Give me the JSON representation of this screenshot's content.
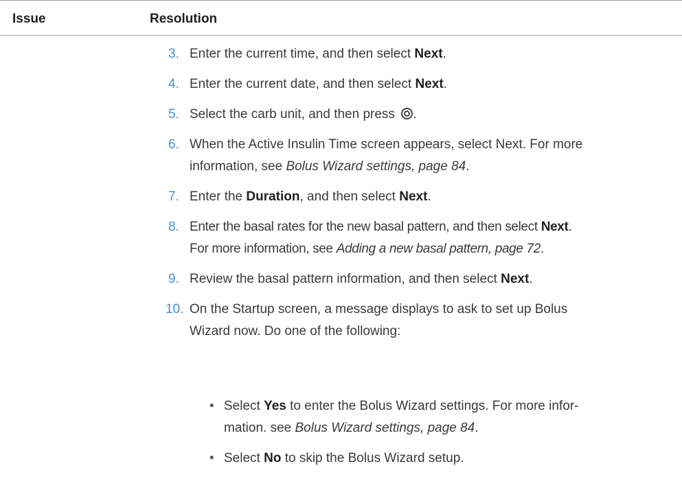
{
  "table": {
    "header_issue": "Issue",
    "header_resolution": "Resolution"
  },
  "steps": [
    {
      "num": "3.",
      "pre": "Enter the current time, and then select ",
      "bold": "Next",
      "post": "."
    },
    {
      "num": "4.",
      "pre": "Enter the current date, and then select ",
      "bold": "Next",
      "post": "."
    },
    {
      "num": "5.",
      "pre": "Select the carb unit, and then press ",
      "icon": "select-button-icon",
      "post": "."
    },
    {
      "num": "6.",
      "line1": "When the Active Insulin Time screen appears, select Next. For more",
      "line2_pre": "information, see ",
      "ref": "Bolus Wizard settings, page 84",
      "post": "."
    },
    {
      "num": "7.",
      "pre": "Enter the ",
      "bold": "Duration",
      "mid": ", and then select ",
      "bold2": "Next",
      "post": "."
    },
    {
      "num": "8.",
      "line1_pre": "Enter the basal rates for the new basal pattern, and then select ",
      "line1_bold": "Next",
      "line1_post": ".",
      "line2_pre": "For more information, see ",
      "ref": "Adding a new basal pattern, page 72",
      "post": "."
    },
    {
      "num": "9.",
      "pre": "Review the basal pattern information, and then select ",
      "bold": "Next",
      "post": "."
    },
    {
      "num": "10.",
      "line1": "On the Startup screen, a message displays to ask to set up Bolus",
      "line2": "Wizard now. Do one of the following:"
    }
  ],
  "bullets": [
    {
      "dot": "•",
      "pre": "Select ",
      "bold": "Yes",
      "line1_post": " to enter the Bolus Wizard settings. For more infor-",
      "line2_pre": "mation. see ",
      "ref": "Bolus Wizard settings, page 84",
      "post": "."
    },
    {
      "dot": "•",
      "pre": "Select ",
      "bold": "No",
      "post": " to skip the Bolus Wizard setup."
    }
  ]
}
